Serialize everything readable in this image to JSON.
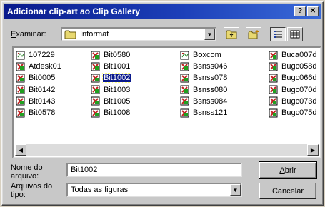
{
  "window": {
    "title": "Adicionar clip-art ao Clip Gallery",
    "help_label": "?",
    "close_label": "✕"
  },
  "lookin": {
    "label_prefix": "E",
    "label_rest": "xaminar:",
    "value": "Informat"
  },
  "files": {
    "columns": [
      [
        {
          "name": "107229",
          "icon": "graphic-file-icon"
        },
        {
          "name": "Atdesk01",
          "icon": "clipart-file-icon"
        },
        {
          "name": "Bit0005",
          "icon": "clipart-file-icon"
        },
        {
          "name": "Bit0142",
          "icon": "clipart-file-icon"
        },
        {
          "name": "Bit0143",
          "icon": "clipart-file-icon"
        },
        {
          "name": "Bit0578",
          "icon": "clipart-file-icon"
        }
      ],
      [
        {
          "name": "Bit0580",
          "icon": "clipart-file-icon"
        },
        {
          "name": "Bit1001",
          "icon": "clipart-file-icon"
        },
        {
          "name": "Bit1002",
          "icon": "clipart-file-icon",
          "selected": true
        },
        {
          "name": "Bit1003",
          "icon": "clipart-file-icon"
        },
        {
          "name": "Bit1005",
          "icon": "clipart-file-icon"
        },
        {
          "name": "Bit1008",
          "icon": "clipart-file-icon"
        }
      ],
      [
        {
          "name": "Boxcom",
          "icon": "graphic-file-icon"
        },
        {
          "name": "Bsnss046",
          "icon": "clipart-file-icon"
        },
        {
          "name": "Bsnss078",
          "icon": "clipart-file-icon"
        },
        {
          "name": "Bsnss080",
          "icon": "clipart-file-icon"
        },
        {
          "name": "Bsnss084",
          "icon": "clipart-file-icon"
        },
        {
          "name": "Bsnss121",
          "icon": "clipart-file-icon"
        }
      ],
      [
        {
          "name": "Buca007d",
          "icon": "clipart-file-icon"
        },
        {
          "name": "Bugc058d",
          "icon": "clipart-file-icon"
        },
        {
          "name": "Bugc066d",
          "icon": "clipart-file-icon"
        },
        {
          "name": "Bugc070d",
          "icon": "clipart-file-icon"
        },
        {
          "name": "Bugc073d",
          "icon": "clipart-file-icon"
        },
        {
          "name": "Bugc075d",
          "icon": "clipart-file-icon"
        }
      ]
    ]
  },
  "filename": {
    "label_line1_prefix": "N",
    "label_line1_rest": "ome do",
    "label_line2": "arquivo:",
    "value": "Bit1002"
  },
  "filetype": {
    "label_line1": "Arquivos do",
    "label_line2_prefix": "t",
    "label_line2_rest": "ipo:",
    "value": "Todas as figuras"
  },
  "buttons": {
    "open_prefix": "A",
    "open_rest": "brir",
    "cancel": "Cancelar"
  },
  "colors": {
    "titlebar": "#0a1a8c",
    "selection": "#0a1a8c",
    "face": "#c8c8c8"
  }
}
